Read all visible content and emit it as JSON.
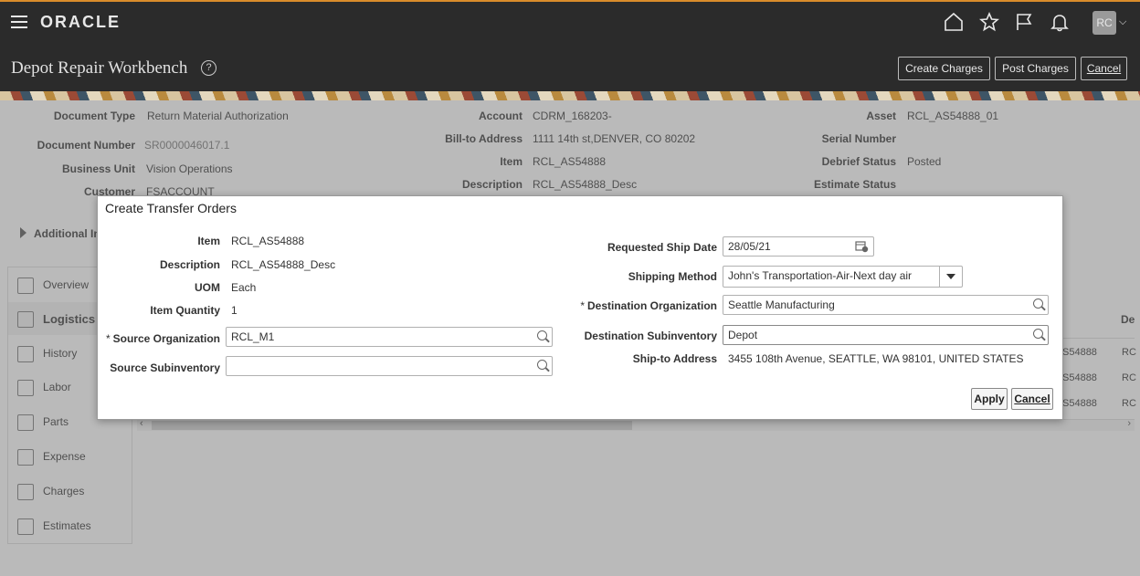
{
  "header": {
    "logo": "ORACLE",
    "page_title": "Depot Repair Workbench",
    "help_icon": "?",
    "user_initials": "RC",
    "buttons": {
      "create_charges": "Create Charges",
      "post_charges": "Post Charges",
      "cancel": "Cancel"
    },
    "icons": [
      "home-icon",
      "star-icon",
      "flag-icon",
      "bell-icon"
    ]
  },
  "details": {
    "col1": [
      {
        "label": "Document Type",
        "value": "Return Material Authorization"
      },
      {
        "label": "Document Number",
        "value": "SR0000046017.1"
      },
      {
        "label": "Business Unit",
        "value": "Vision Operations"
      },
      {
        "label": "Customer",
        "value": "FSACCOUNT"
      }
    ],
    "col2": [
      {
        "label": "Account",
        "value": "CDRM_168203-"
      },
      {
        "label": "Bill-to Address",
        "value": "1111 14th st,DENVER, CO 80202"
      },
      {
        "label": "Item",
        "value": "RCL_AS54888"
      },
      {
        "label": "Description",
        "value": "RCL_AS54888_Desc"
      }
    ],
    "col3": [
      {
        "label": "Asset",
        "value": "RCL_AS54888_01"
      },
      {
        "label": "Serial Number",
        "value": ""
      },
      {
        "label": "Debrief Status",
        "value": "Posted"
      },
      {
        "label": "Estimate Status",
        "value": ""
      }
    ],
    "additional": "Additional In"
  },
  "sidebar": {
    "items": [
      {
        "label": "Overview"
      },
      {
        "label": "Logistics"
      },
      {
        "label": "History"
      },
      {
        "label": "Labor"
      },
      {
        "label": "Parts"
      },
      {
        "label": "Expense"
      },
      {
        "label": "Charges"
      },
      {
        "label": "Estimates"
      }
    ]
  },
  "table_peek": {
    "col_header": "De",
    "rows": [
      "S54888",
      "S54888",
      "S54888"
    ],
    "rc": "RC"
  },
  "dialog": {
    "title": "Create Transfer Orders",
    "left": {
      "item_label": "Item",
      "item_value": "RCL_AS54888",
      "desc_label": "Description",
      "desc_value": "RCL_AS54888_Desc",
      "uom_label": "UOM",
      "uom_value": "Each",
      "qty_label": "Item Quantity",
      "qty_value": "1",
      "source_org_label": "Source Organization",
      "source_org_value": "RCL_M1",
      "source_sub_label": "Source Subinventory",
      "source_sub_value": ""
    },
    "right": {
      "ship_date_label": "Requested Ship Date",
      "ship_date_value": "28/05/21",
      "ship_method_label": "Shipping Method",
      "ship_method_value": "John's Transportation-Air-Next day air",
      "dest_org_label": "Destination Organization",
      "dest_org_value": "Seattle Manufacturing",
      "dest_sub_label": "Destination Subinventory",
      "dest_sub_value": "Depot",
      "ship_to_label": "Ship-to Address",
      "ship_to_value": "3455 108th Avenue, SEATTLE, WA 98101, UNITED STATES"
    },
    "required_mark": "*",
    "apply": "Apply",
    "cancel": "Cancel"
  }
}
